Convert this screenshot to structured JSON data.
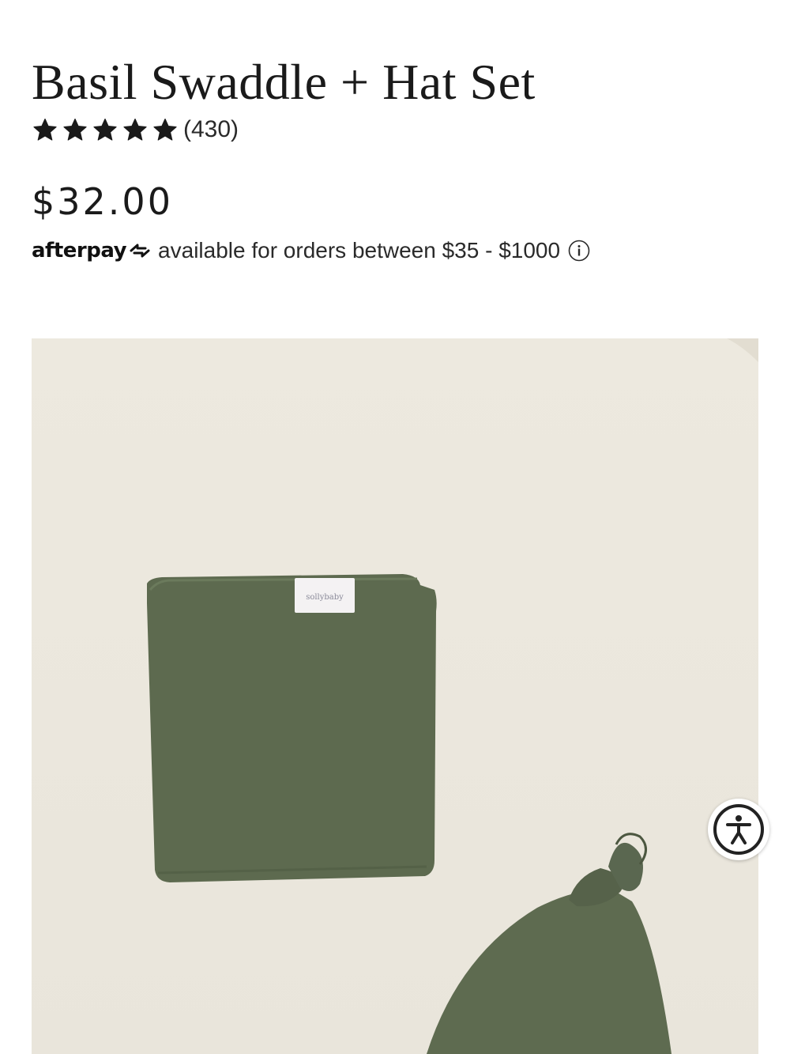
{
  "product": {
    "title": "Basil Swaddle + Hat Set",
    "rating": {
      "stars": 5,
      "max_stars": 5,
      "review_count": "(430)"
    },
    "price": "$32.00",
    "afterpay": {
      "brand": "afterpay",
      "message": "available for orders between $35 - $1000"
    },
    "image": {
      "label_text": "sollybaby",
      "product_color": "#5e6b50",
      "background_color": "#ece8de"
    }
  },
  "icons": {
    "star": "star-icon",
    "afterpay": "afterpay-arrows-icon",
    "info": "info-icon",
    "accessibility": "accessibility-icon"
  }
}
